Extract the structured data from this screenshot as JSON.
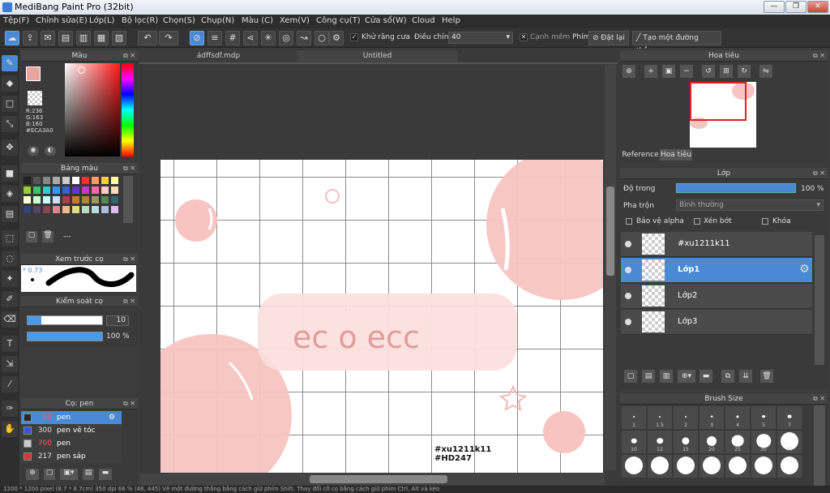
{
  "window": {
    "title": "MediBang Paint Pro (32bit)"
  },
  "menu": [
    "Tệp(F)",
    "Chỉnh sửa(E)",
    "Lớp(L)",
    "Bộ lọc(R)",
    "Chọn(S)",
    "Chụp(N)",
    "Màu (C)",
    "Xem(V)",
    "Công cụ(T)",
    "Cửa sổ(W)",
    "Cloud",
    "Help"
  ],
  "toolbar": {
    "antialias": "Khử răng cưa",
    "adjust": "Điều chỉnh",
    "adjust_value": "40",
    "soft_edge": "Cạnh mềm",
    "key_label": "Phím",
    "reset": "Đặt lại",
    "create_line": "Tạo một đường thẳng"
  },
  "color_panel": {
    "title": "Màu",
    "r": "R:236",
    "g": "G:163",
    "b": "B:160",
    "hex": "#ECA3A0",
    "fg": "#ECA3A0"
  },
  "palette_panel": {
    "title": "Bảng màu",
    "extra": "---"
  },
  "brush_preview": {
    "title": "Xem trước cọ",
    "size": "0.73"
  },
  "brush_control": {
    "title": "Kiểm soát cọ",
    "size": "10",
    "opacity": "100 %"
  },
  "brush_list": {
    "title": "Cọ: pen",
    "items": [
      {
        "size": "10",
        "name": "pen",
        "color": "#2a2a2a"
      },
      {
        "size": "300",
        "name": "pen vẽ tóc",
        "color": "#3355dd"
      },
      {
        "size": "700",
        "name": "pen",
        "color": "#cccccc"
      },
      {
        "size": "217",
        "name": "pen sáp",
        "color": "#dd3333"
      }
    ]
  },
  "tabs": {
    "file1": "ádffsdf.mdp",
    "file2": "Untitled"
  },
  "canvas": {
    "text": "ec o ecc",
    "sig1": "#xu1211k11",
    "sig2": "#HD247"
  },
  "navigator": {
    "title": "Hoa tiêu",
    "tab_reference": "Reference",
    "tab_nav": "Hoa tiêu"
  },
  "layers": {
    "title": "Lớp",
    "opacity_label": "Độ trong",
    "opacity_value": "100 %",
    "opacity": 1.0,
    "blend_label": "Pha trộn",
    "blend_value": "Bình thường",
    "protect_alpha": "Bảo vệ alpha",
    "clip": "Xén bớt",
    "lock": "Khóa",
    "items": [
      "#xu1211k11",
      "Lớp1",
      "Lớp2",
      "Lớp3"
    ]
  },
  "brush_size": {
    "title": "Brush Size",
    "labels": [
      "1",
      "1.5",
      "2",
      "3",
      "4",
      "5",
      "7",
      "10",
      "12",
      "15",
      "20",
      "25",
      "30",
      "40"
    ]
  },
  "status": {
    "text": "1200 * 1200 pixel (8.7 * 8.7cm) 350 dpi 66 % (48, 445) Vẽ một đường thẳng bằng cách giữ phím Shift. Thay đổi cỡ cọ bằng cách giữ phím Ctrl, Alt và kéo"
  }
}
